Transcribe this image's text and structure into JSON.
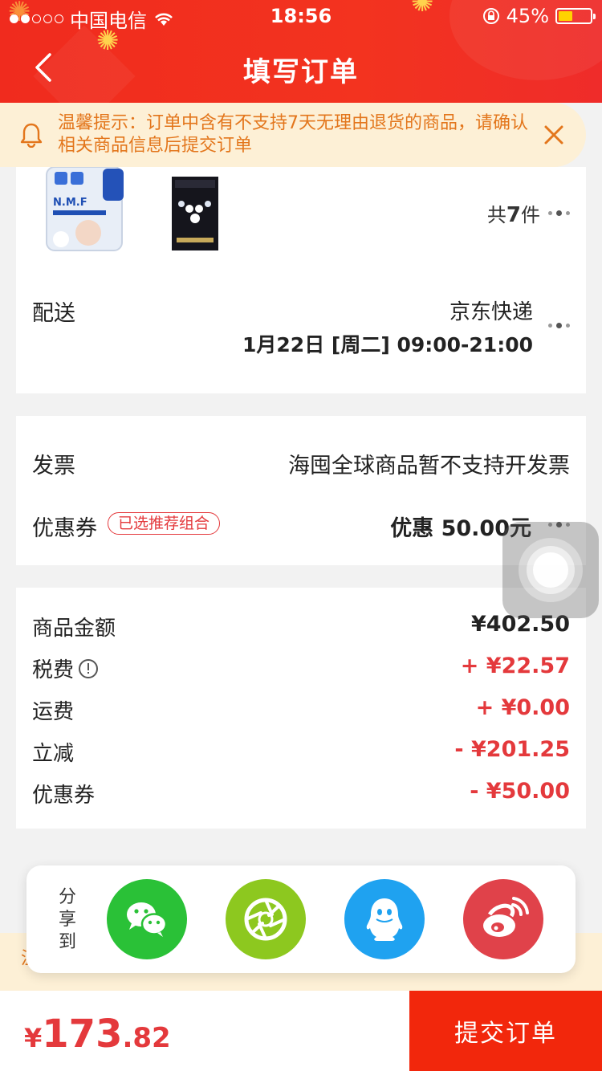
{
  "status_bar": {
    "carrier": "中国电信",
    "time": "18:56",
    "battery": "45%",
    "battery_level": 0.45
  },
  "nav": {
    "title": "填写订单"
  },
  "notice": {
    "text": "温馨提示：订单中含有不支持7天无理由退货的商品，请确认相关商品信息后提交订单"
  },
  "products": {
    "count_prefix": "共",
    "count": "7",
    "count_suffix": "件",
    "items": [
      "N.M.F",
      "mask-box"
    ]
  },
  "shipping": {
    "label": "配送",
    "method": "京东快递",
    "time": "1月22日 [周二] 09:00-21:00"
  },
  "invoice": {
    "label": "发票",
    "value": "海囤全球商品暂不支持开发票"
  },
  "coupon": {
    "label": "优惠券",
    "badge": "已选推荐组合",
    "value": "优惠 50.00元"
  },
  "amounts": [
    {
      "label": "商品金额",
      "value": "¥402.50",
      "color": "#222222"
    },
    {
      "label": "税费",
      "value": "+ ¥22.57",
      "color": "#e4393c"
    },
    {
      "label": "运费",
      "value": "+ ¥0.00",
      "color": "#e4393c"
    },
    {
      "label": "立减",
      "value": "- ¥201.25",
      "color": "#e4393c"
    },
    {
      "label": "优惠券",
      "value": "- ¥50.00",
      "color": "#e4393c"
    }
  ],
  "share": {
    "label": "分享到",
    "targets": [
      "wechat-icon",
      "moments-icon",
      "qq-icon",
      "weibo-icon"
    ]
  },
  "footer": {
    "currency": "¥",
    "price_int": "173",
    "price_dec": ".82",
    "submit_label": "提交订单"
  },
  "colors": {
    "accent": "#f2270c",
    "notice_bg": "#fdf0d6",
    "notice_text": "#e3761c"
  }
}
